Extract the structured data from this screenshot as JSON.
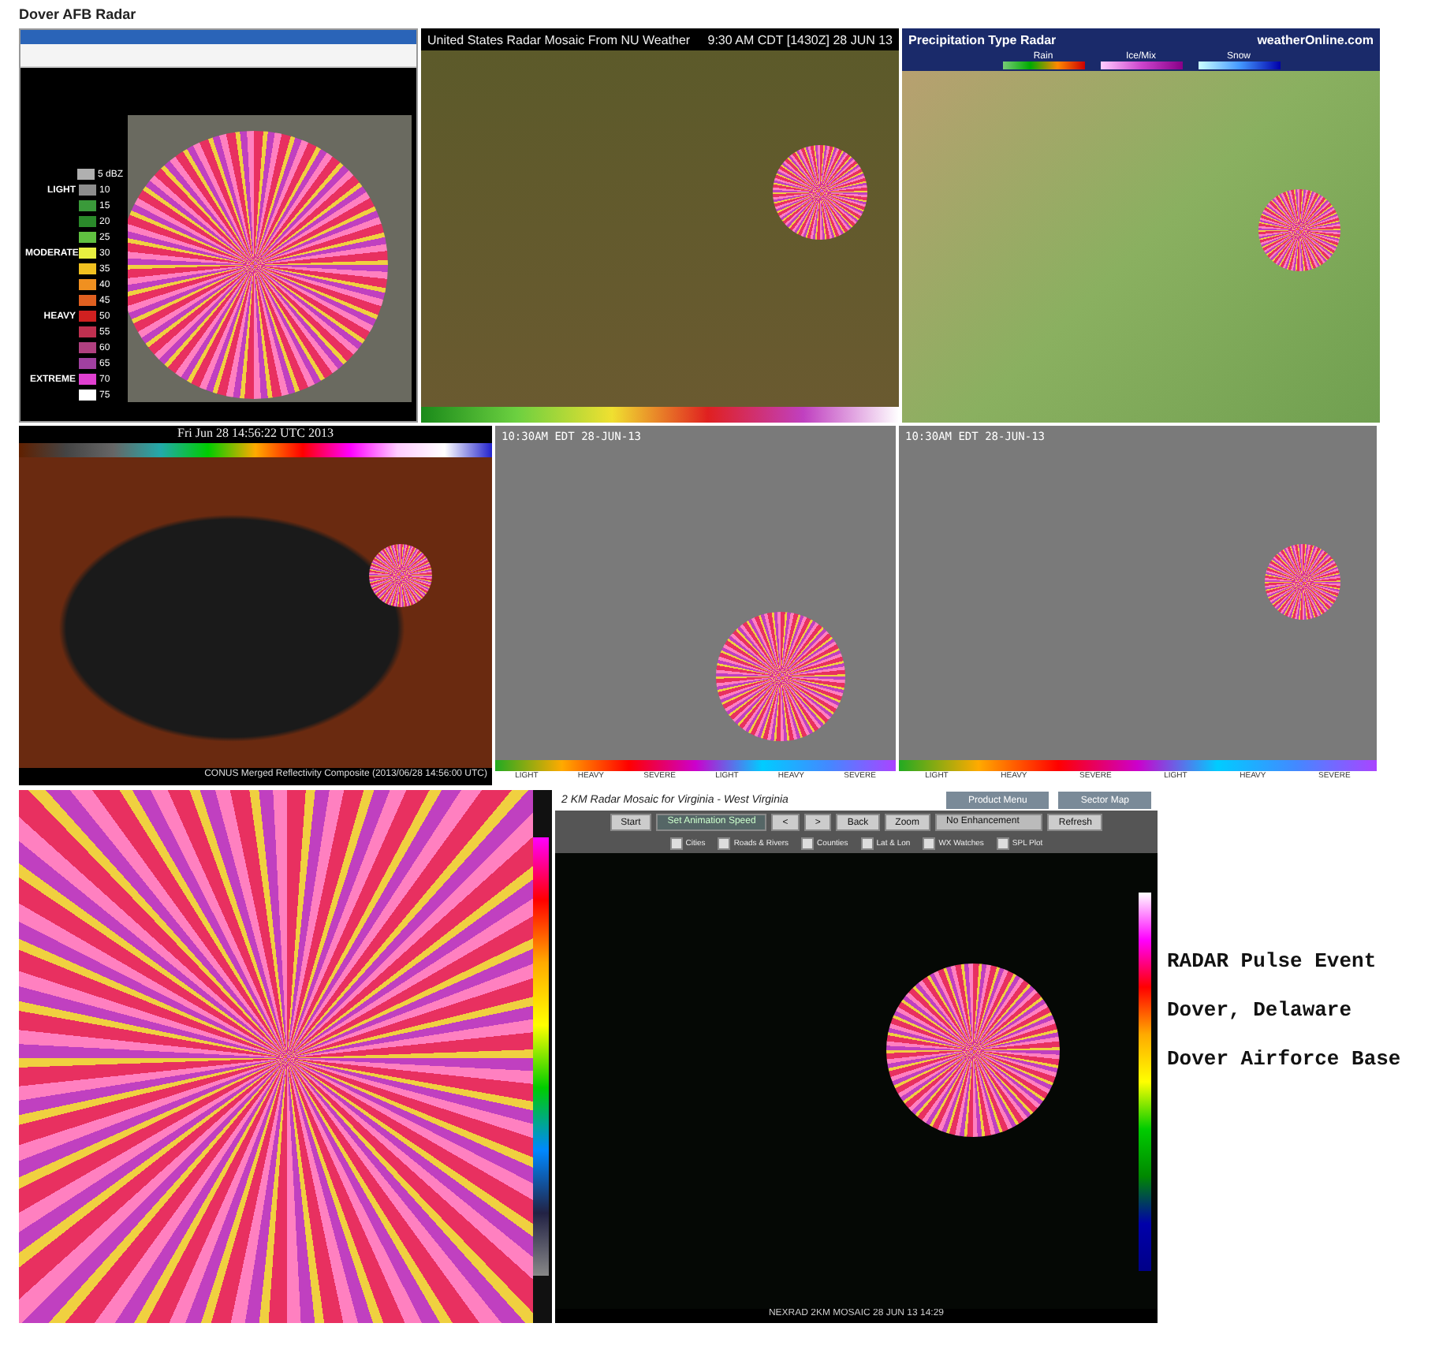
{
  "title": "Dover AFB Radar",
  "panel_a": {
    "legend": [
      {
        "value": "5 dBZ",
        "color": "#b0b0b0"
      },
      {
        "category": "LIGHT",
        "value": "10",
        "color": "#8c8c8c"
      },
      {
        "value": "15",
        "color": "#3a9a3a"
      },
      {
        "value": "20",
        "color": "#2a8a2a"
      },
      {
        "value": "25",
        "color": "#60c040"
      },
      {
        "category": "MODERATE",
        "value": "30",
        "color": "#e8f040"
      },
      {
        "value": "35",
        "color": "#f0c020"
      },
      {
        "value": "40",
        "color": "#f09020"
      },
      {
        "value": "45",
        "color": "#e06020"
      },
      {
        "category": "HEAVY",
        "value": "50",
        "color": "#d02020"
      },
      {
        "value": "55",
        "color": "#c03050"
      },
      {
        "value": "60",
        "color": "#b04080"
      },
      {
        "value": "65",
        "color": "#a040a0"
      },
      {
        "category": "EXTREME",
        "value": "70",
        "color": "#e040d0"
      },
      {
        "value": "75",
        "color": "#ffffff"
      }
    ]
  },
  "panel_b": {
    "title": "United States Radar Mosaic From NU Weather",
    "time": "9:30 AM CDT [1430Z] 28 JUN 13"
  },
  "panel_c": {
    "title": "Precipitation Type Radar",
    "source": "weatherOnline.com",
    "legend": [
      "Rain",
      "Ice/Mix",
      "Snow"
    ]
  },
  "panel_d": {
    "title": "Fri Jun 28 14:56:22 UTC 2013",
    "footer": "CONUS Merged Reflectivity Composite (2013/06/28 14:56:00 UTC)"
  },
  "panel_e": {
    "time": "10:30AM EDT 28-JUN-13",
    "legend": [
      "LIGHT",
      "HEAVY",
      "SEVERE",
      "LIGHT",
      "HEAVY",
      "SEVERE"
    ]
  },
  "panel_f": {
    "time": "10:30AM EDT 28-JUN-13",
    "legend": [
      "LIGHT",
      "HEAVY",
      "SEVERE",
      "LIGHT",
      "HEAVY",
      "SEVERE"
    ]
  },
  "panel_h": {
    "title": "2 KM Radar Mosaic for Virginia - West Virginia",
    "tabs": [
      {
        "label": "Product Menu",
        "selected": false
      },
      {
        "label": "Sector Map",
        "selected": false
      }
    ],
    "toolbar": [
      {
        "kind": "button",
        "label": "Start"
      },
      {
        "kind": "field",
        "label": "Set Animation Speed"
      },
      {
        "kind": "button",
        "label": "<"
      },
      {
        "kind": "button",
        "label": ">"
      },
      {
        "kind": "button",
        "label": "Back"
      },
      {
        "kind": "button",
        "label": "Zoom"
      },
      {
        "kind": "select",
        "label": "No Enhancement"
      },
      {
        "kind": "button",
        "label": "Refresh"
      }
    ],
    "options": [
      {
        "label": "Cities",
        "checked": false
      },
      {
        "label": "Roads & Rivers",
        "checked": false
      },
      {
        "label": "Counties",
        "checked": false
      },
      {
        "label": "Lat & Lon",
        "checked": false
      },
      {
        "label": "WX Watches",
        "checked": false
      },
      {
        "label": "SPL Plot",
        "checked": false
      }
    ],
    "footer": "NEXRAD 2KM MOSAIC 28 JUN 13 14:29"
  },
  "notes": [
    "RADAR Pulse Event",
    "Dover, Delaware",
    "Dover Airforce Base"
  ]
}
